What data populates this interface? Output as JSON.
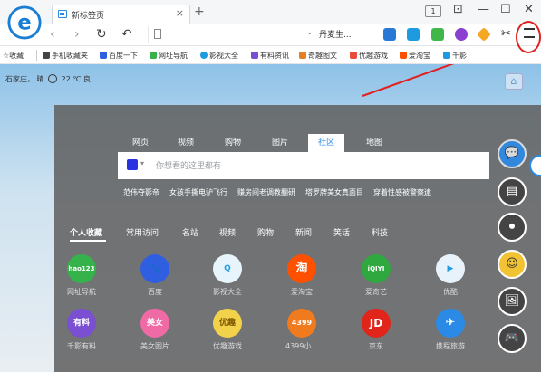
{
  "titlebar": {
    "tab_title": "新标签页",
    "tab_close": "×",
    "new_tab": "+",
    "window_count": "1",
    "minimize": "—",
    "maximize": "☐",
    "close": "✕"
  },
  "addressbar": {
    "back": "‹",
    "forward": "›",
    "refresh": "↻",
    "undo": "↶",
    "dropdown": "⌄",
    "search_engine_label": "丹麦生..."
  },
  "bookmarks": {
    "favorites": "☆收藏",
    "items": [
      "手机收藏夹",
      "百度一下",
      "网址导航",
      "影视大全",
      "有料资讯",
      "奇趣图文",
      "优趣游戏",
      "爱淘宝",
      "千影"
    ]
  },
  "weather": {
    "city": "石家庄",
    "condition": "晴",
    "temperature": "22 ℃",
    "quality": "良"
  },
  "search": {
    "tabs": [
      "网页",
      "视频",
      "购物",
      "图片",
      "社区",
      "地图"
    ],
    "active_tab": "社区",
    "placeholder": "你想看的这里都有",
    "hot_words": [
      "范伟夺影帝",
      "女孩手撕电驴飞行",
      "赚房间老调教翻研",
      "塔罗牌美女真面目",
      "穿着性感被警察逮"
    ]
  },
  "categories": {
    "tabs": [
      "个人收藏",
      "常用访问",
      "名站",
      "视频",
      "购物",
      "新闻",
      "笑话",
      "科技"
    ],
    "active": "个人收藏"
  },
  "apps": [
    {
      "label": "网址导航",
      "glyph": "hao123",
      "color": "#36b24a"
    },
    {
      "label": "百度",
      "glyph": "🐾",
      "color": "#2f5fe0"
    },
    {
      "label": "影视大全",
      "glyph": "Q",
      "color": "#e7f4fb"
    },
    {
      "label": "爱淘宝",
      "glyph": "淘",
      "color": "#ff5000"
    },
    {
      "label": "爱奇艺",
      "glyph": "iQIYI",
      "color": "#30a840"
    },
    {
      "label": "优酷",
      "glyph": "▶",
      "color": "#e8f2fb"
    },
    {
      "label": "千影有料",
      "glyph": "有料",
      "color": "#7a4fd1"
    },
    {
      "label": "美女图片",
      "glyph": "美女",
      "color": "#f06aa6"
    },
    {
      "label": "优趣游戏",
      "glyph": "优趣",
      "color": "#f1d24a"
    },
    {
      "label": "4399小...",
      "glyph": "4399",
      "color": "#f07a1e"
    },
    {
      "label": "京东",
      "glyph": "JD",
      "color": "#e1251b"
    },
    {
      "label": "携程旅游",
      "glyph": "✈",
      "color": "#2a8ae6"
    }
  ],
  "sidebar": {
    "chat": "💬",
    "news": "▤",
    "video": "⏺",
    "smile": "☺",
    "picture": "🖼",
    "game": "🎮"
  }
}
